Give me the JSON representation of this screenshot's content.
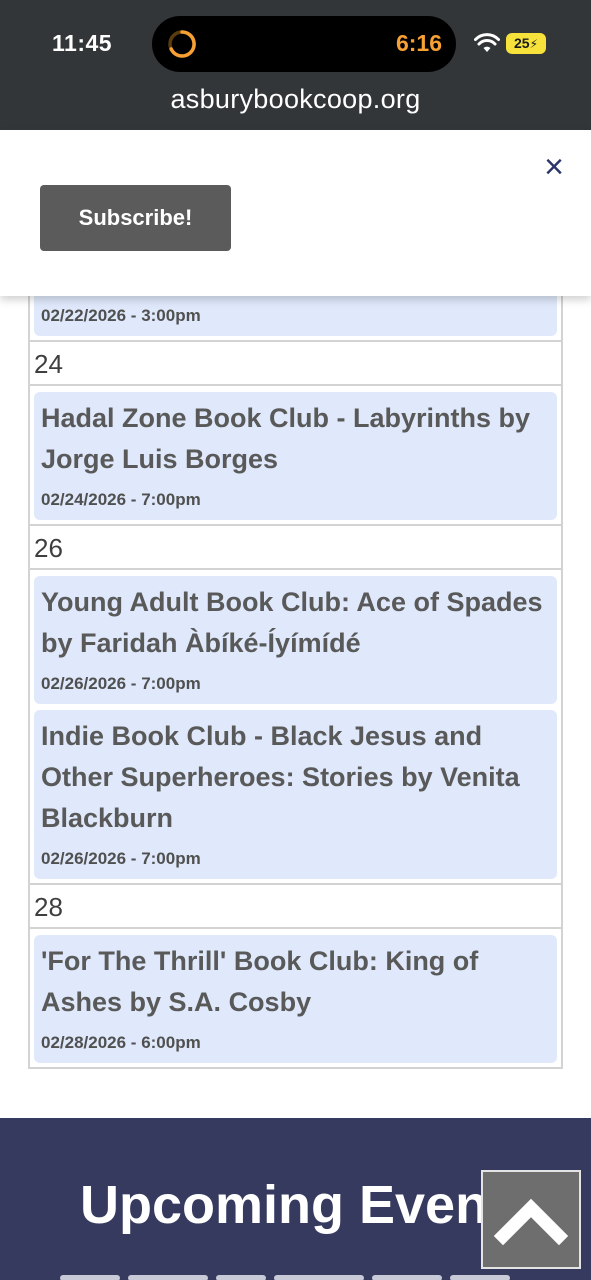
{
  "status_bar": {
    "time": "11:45",
    "timer": "6:16",
    "battery": "25",
    "url": "asburybookcoop.org"
  },
  "subscribe": {
    "button_label": "Subscribe!",
    "close_label": "×"
  },
  "calendar": {
    "partial_first_date": "02/22/2026 - 3:00pm",
    "days": [
      {
        "day": "24",
        "events": [
          {
            "title": "Hadal Zone Book Club - Labyrinths by Jorge Luis Borges",
            "date": "02/24/2026 - 7:00pm"
          }
        ]
      },
      {
        "day": "26",
        "events": [
          {
            "title": "Young Adult Book Club: Ace of Spades by Faridah Àbíké-Íyímídé",
            "date": "02/26/2026 - 7:00pm"
          },
          {
            "title": "Indie Book Club - Black Jesus and Other Superheroes: Stories by Venita Blackburn",
            "date": "02/26/2026 - 7:00pm"
          }
        ]
      },
      {
        "day": "28",
        "events": [
          {
            "title": "'For The Thrill' Book Club: King of Ashes by S.A. Cosby",
            "date": "02/28/2026 - 6:00pm"
          }
        ]
      }
    ]
  },
  "footer": {
    "title": "Upcoming Events"
  },
  "icons": {
    "timer": "timer-icon",
    "wifi": "wifi-icon",
    "close": "close-icon",
    "scroll_top": "chevron-up-icon"
  },
  "colors": {
    "status_bg": "#333638",
    "event_bg": "#dfe9fb",
    "footer_bg": "#353a5e",
    "close_color": "#2c3569",
    "timer_color": "#f7a033"
  }
}
